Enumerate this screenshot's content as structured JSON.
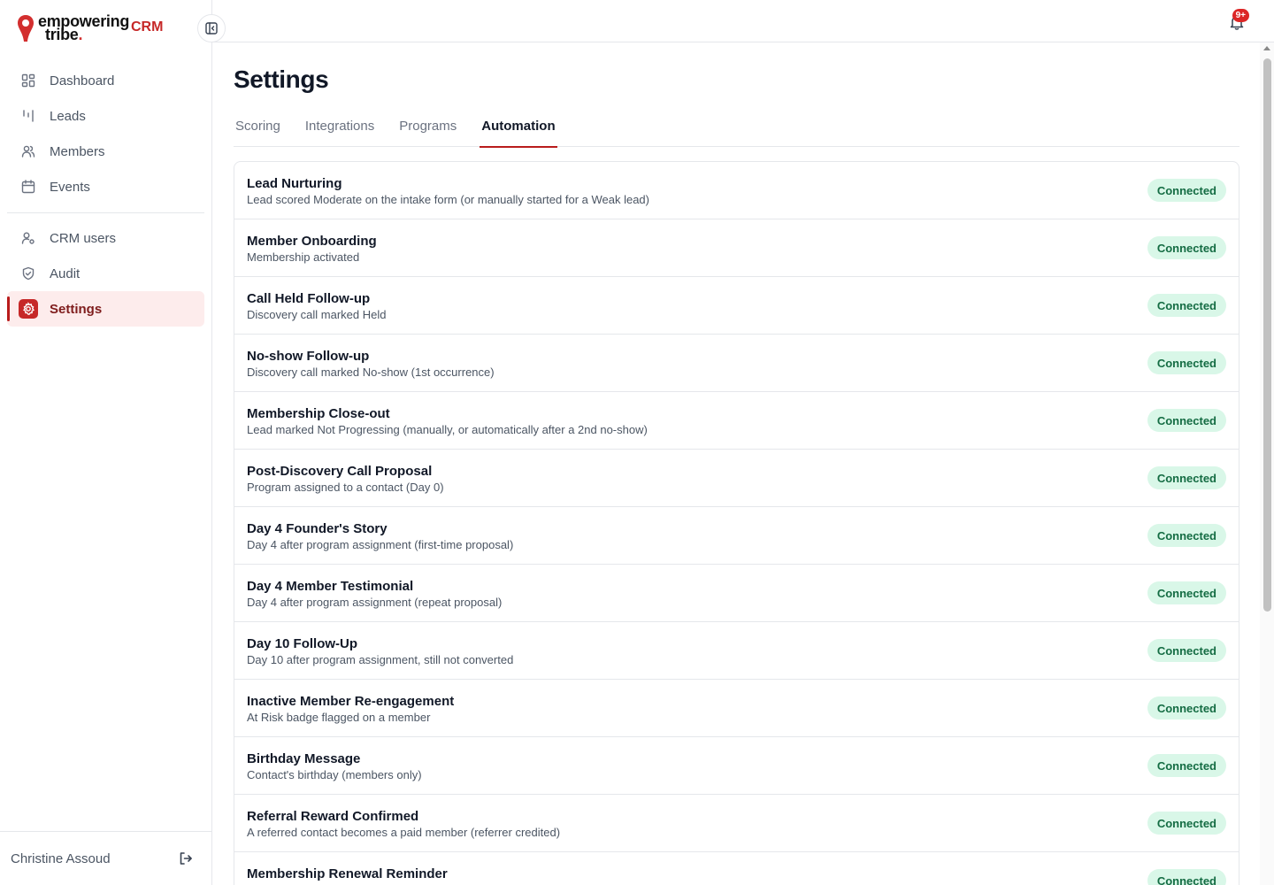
{
  "brand": {
    "line1": "empowering",
    "line2": "tribe",
    "dot": ".",
    "crm": "CRM"
  },
  "sidebar": {
    "items_top": [
      {
        "label": "Dashboard",
        "icon": "grid-icon"
      },
      {
        "label": "Leads",
        "icon": "bars-icon"
      },
      {
        "label": "Members",
        "icon": "users-icon"
      },
      {
        "label": "Events",
        "icon": "calendar-icon"
      }
    ],
    "items_bottom": [
      {
        "label": "CRM users",
        "icon": "user-gear-icon"
      },
      {
        "label": "Audit",
        "icon": "shield-check-icon"
      },
      {
        "label": "Settings",
        "icon": "gear-icon",
        "active": true
      }
    ],
    "user_name": "Christine Assoud"
  },
  "topbar": {
    "notification_count": "9+"
  },
  "page": {
    "title": "Settings",
    "tabs": [
      {
        "label": "Scoring"
      },
      {
        "label": "Integrations"
      },
      {
        "label": "Programs"
      },
      {
        "label": "Automation",
        "active": true
      }
    ]
  },
  "automations": [
    {
      "title": "Lead Nurturing",
      "desc": "Lead scored Moderate on the intake form (or manually started for a Weak lead)",
      "status": "Connected"
    },
    {
      "title": "Member Onboarding",
      "desc": "Membership activated",
      "status": "Connected"
    },
    {
      "title": "Call Held Follow-up",
      "desc": "Discovery call marked Held",
      "status": "Connected"
    },
    {
      "title": "No-show Follow-up",
      "desc": "Discovery call marked No-show (1st occurrence)",
      "status": "Connected"
    },
    {
      "title": "Membership Close-out",
      "desc": "Lead marked Not Progressing (manually, or automatically after a 2nd no-show)",
      "status": "Connected"
    },
    {
      "title": "Post-Discovery Call Proposal",
      "desc": "Program assigned to a contact (Day 0)",
      "status": "Connected"
    },
    {
      "title": "Day 4 Founder's Story",
      "desc": "Day 4 after program assignment (first-time proposal)",
      "status": "Connected"
    },
    {
      "title": "Day 4 Member Testimonial",
      "desc": "Day 4 after program assignment (repeat proposal)",
      "status": "Connected"
    },
    {
      "title": "Day 10 Follow-Up",
      "desc": "Day 10 after program assignment, still not converted",
      "status": "Connected"
    },
    {
      "title": "Inactive Member Re-engagement",
      "desc": "At Risk badge flagged on a member",
      "status": "Connected"
    },
    {
      "title": "Birthday Message",
      "desc": "Contact's birthday (members only)",
      "status": "Connected"
    },
    {
      "title": "Referral Reward Confirmed",
      "desc": "A referred contact becomes a paid member (referrer credited)",
      "status": "Connected"
    },
    {
      "title": "Membership Renewal Reminder",
      "desc": "",
      "status": "Connected"
    }
  ],
  "colors": {
    "accent": "#c62828",
    "badge_bg": "#d9f7e8",
    "badge_text": "#146c43"
  }
}
